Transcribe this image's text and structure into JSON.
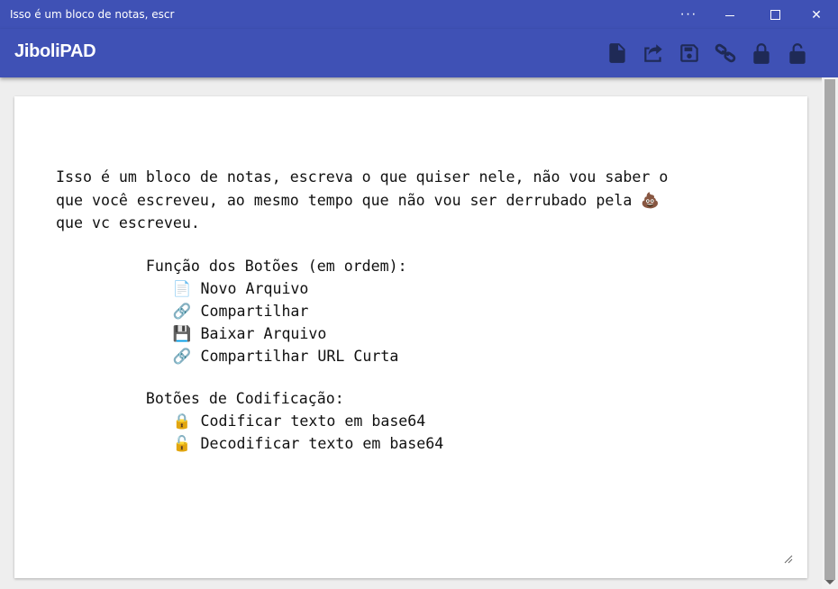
{
  "window": {
    "title": "Isso é um bloco de notas, escr",
    "more_label": "···",
    "close_label": "✕"
  },
  "app": {
    "brand": "JiboliPAD",
    "toolbar": [
      {
        "icon": "new-file-icon",
        "name": "new-file-button"
      },
      {
        "icon": "share-icon",
        "name": "share-button"
      },
      {
        "icon": "save-icon",
        "name": "download-button"
      },
      {
        "icon": "link-icon",
        "name": "short-url-button"
      },
      {
        "icon": "lock-icon",
        "name": "encode-button"
      },
      {
        "icon": "unlock-icon",
        "name": "decode-button"
      }
    ],
    "accent": "#3f51b5"
  },
  "editor": {
    "intro": [
      "Isso é um bloco de notas, escreva o que quiser nele, não vou saber o",
      "que você escreveu, ao mesmo tempo que não vou ser derrubado pela 💩",
      "que vc escreveu."
    ],
    "buttons_heading": "          Função dos Botões (em ordem):",
    "buttons": [
      "             📄 Novo Arquivo",
      "             🔗 Compartilhar",
      "             💾 Baixar Arquivo",
      "             🔗 Compartilhar URL Curta"
    ],
    "encoding_heading": "          Botões de Codificação:",
    "encoding": [
      "             🔒 Codificar texto em base64",
      "             🔓 Decodificar texto em base64"
    ]
  }
}
